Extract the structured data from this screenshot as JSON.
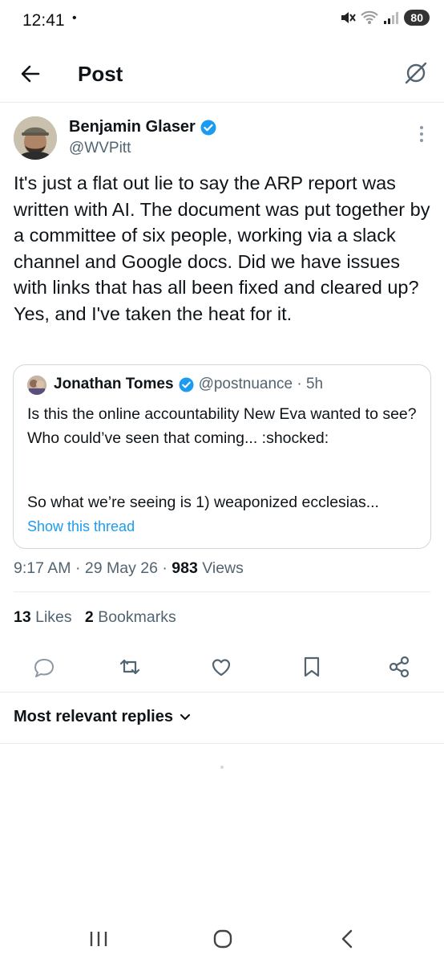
{
  "status_bar": {
    "time": "12:41",
    "dot": "•",
    "battery": "80"
  },
  "header": {
    "title": "Post"
  },
  "post": {
    "author_name": "Benjamin Glaser",
    "author_handle": "@WVPitt",
    "text": "It's just a flat out lie to say the ARP report was written with AI. The document was put together by a committee of six people, working via a slack channel and Google docs. Did we have issues with links that has all been fixed and cleared up? Yes, and I've taken the heat for it.",
    "quote": {
      "name": "Jonathan Tomes",
      "handle_time": "@postnuance · 5h",
      "text": "Is this the online accountability New Eva wanted to see? Who could’ve seen that coming... :shocked:",
      "text2": "So what we’re seeing is 1) weaponized ecclesias...",
      "show_thread": "Show this thread"
    },
    "time": "9:17 AM · 29 May 26 · ",
    "views_count": "983",
    "views_label": " Views",
    "likes_count": "13",
    "likes_label": " Likes",
    "bookmarks_count": "2",
    "bookmarks_label": " Bookmarks"
  },
  "actions": [
    "reply-icon",
    "repost-icon",
    "like-icon",
    "bookmark-icon",
    "share-icon"
  ],
  "replies_sort": "Most relevant replies",
  "colors": {
    "accent": "#1d9bf0",
    "secondary_text": "#536471",
    "border": "#cfd9de"
  }
}
